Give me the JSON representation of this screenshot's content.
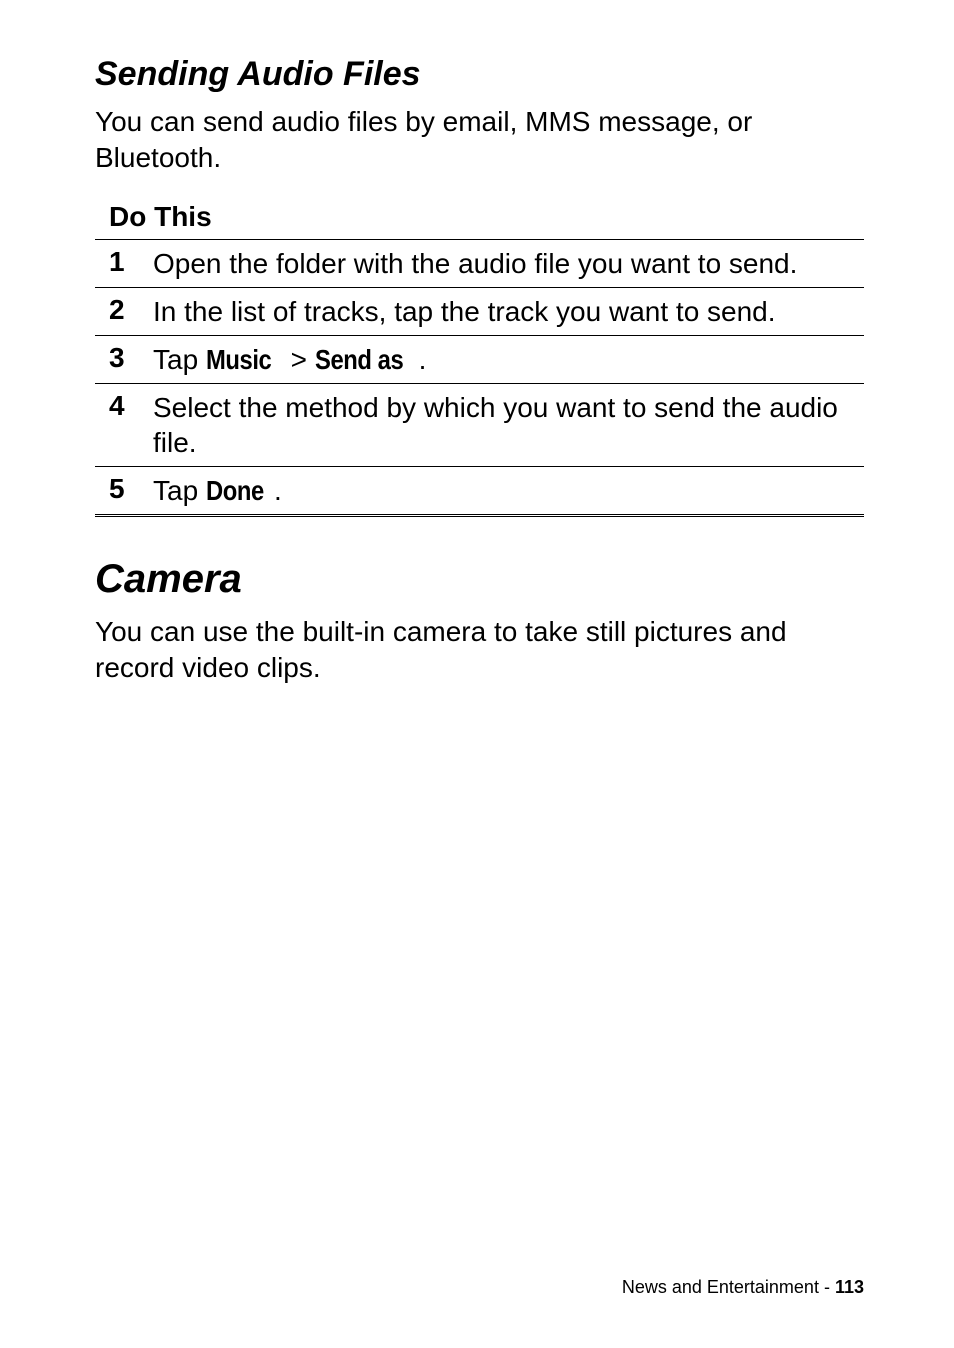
{
  "section1": {
    "heading": "Sending Audio Files",
    "intro": "You can send audio files by email, MMS message, or Bluetooth."
  },
  "steps_header": "Do This",
  "steps": [
    {
      "num": "1",
      "text_plain": "Open the folder with the audio file you want to send."
    },
    {
      "num": "2",
      "text_plain": "In the list of tracks, tap the track you want to send."
    },
    {
      "num": "3",
      "text_prefix": "Tap ",
      "ui1": "Music",
      "mid": " > ",
      "ui2": "Send as",
      "suffix": "."
    },
    {
      "num": "4",
      "text_plain": "Select the method by which you want to send the audio file."
    },
    {
      "num": "5",
      "text_prefix": "Tap ",
      "ui1": "Done",
      "suffix": "."
    }
  ],
  "section2": {
    "heading": "Camera",
    "intro": "You can use the built-in camera to take still pictures and record video clips."
  },
  "footer": {
    "section_name": "News and Entertainment",
    "separator": " - ",
    "page": "113"
  }
}
